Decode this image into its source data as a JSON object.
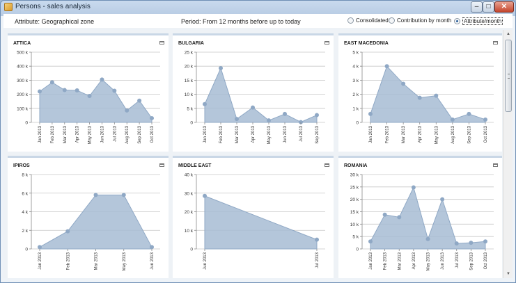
{
  "window": {
    "title": "Persons - sales analysis"
  },
  "toolbar": {
    "attribute": "Attribute: Geographical zone",
    "period": "Period: From 12 months before up to today",
    "options": [
      {
        "label": "Consolidated",
        "selected": false
      },
      {
        "label": "Contribution by month",
        "selected": false
      },
      {
        "label": "Attribute/month",
        "selected": true
      }
    ]
  },
  "colors": {
    "fill": "#a7bcd4",
    "line": "#8fa8c5",
    "point": "#8fa8c5",
    "grid": "#c7c7c7"
  },
  "chart_data": [
    {
      "type": "area",
      "title": "ATTICA",
      "x": [
        "Jan 2013",
        "Feb 2013",
        "Mar 2013",
        "Apr 2013",
        "May 2013",
        "Jun 2013",
        "Jul 2013",
        "Aug 2013",
        "Sep 2013",
        "Oct 2013"
      ],
      "values": [
        220000,
        285000,
        230000,
        228000,
        188000,
        305000,
        225000,
        85000,
        155000,
        30000
      ],
      "ylim": [
        0,
        500000
      ],
      "yticks": [
        "0",
        "100 k",
        "200 k",
        "300 k",
        "400 k",
        "500 k"
      ]
    },
    {
      "type": "area",
      "title": "BULGARIA",
      "x": [
        "Jan 2013",
        "Feb 2013",
        "Mar 2013",
        "Apr 2013",
        "May 2013",
        "Jun 2013",
        "Jul 2013",
        "Sep 2013"
      ],
      "values": [
        6500,
        19300,
        1200,
        5300,
        700,
        3000,
        100,
        2600
      ],
      "ylim": [
        0,
        25000
      ],
      "yticks": [
        "0",
        "5 k",
        "10 k",
        "15 k",
        "20 k",
        "25 k"
      ]
    },
    {
      "type": "area",
      "title": "EAST MACEDONIA",
      "x": [
        "Jan 2013",
        "Feb 2013",
        "Mar 2013",
        "Apr 2013",
        "May 2013",
        "Aug 2013",
        "Sep 2013",
        "Oct 2013"
      ],
      "values": [
        600,
        4000,
        2750,
        1750,
        1900,
        200,
        600,
        200
      ],
      "ylim": [
        0,
        5000
      ],
      "yticks": [
        "0",
        "1 k",
        "2 k",
        "3 k",
        "4 k",
        "5 k"
      ]
    },
    {
      "type": "area",
      "title": "IPIROS",
      "x": [
        "Jan 2013",
        "Feb 2013",
        "Mar 2013",
        "May 2013",
        "Jun 2013"
      ],
      "values": [
        200,
        1900,
        5800,
        5800,
        200
      ],
      "ylim": [
        0,
        8000
      ],
      "yticks": [
        "0",
        "2 k",
        "4 k",
        "6 k",
        "8 k"
      ]
    },
    {
      "type": "area",
      "title": "MIDDLE EAST",
      "x": [
        "Jun 2013",
        "Jul 2013"
      ],
      "values": [
        28500,
        5000
      ],
      "ylim": [
        0,
        40000
      ],
      "yticks": [
        "0",
        "10 k",
        "20 k",
        "30 k",
        "40 k"
      ]
    },
    {
      "type": "area",
      "title": "ROMANIA",
      "x": [
        "Jan 2013",
        "Feb 2013",
        "Mar 2013",
        "Apr 2013",
        "May 2013",
        "Jun 2013",
        "Jul 2013",
        "Sep 2013",
        "Oct 2013"
      ],
      "values": [
        3000,
        13800,
        12800,
        24800,
        4000,
        20000,
        2200,
        2500,
        3000
      ],
      "ylim": [
        0,
        30000
      ],
      "yticks": [
        "0",
        "5 k",
        "10 k",
        "15 k",
        "20 k",
        "25 k",
        "30 k"
      ]
    }
  ]
}
